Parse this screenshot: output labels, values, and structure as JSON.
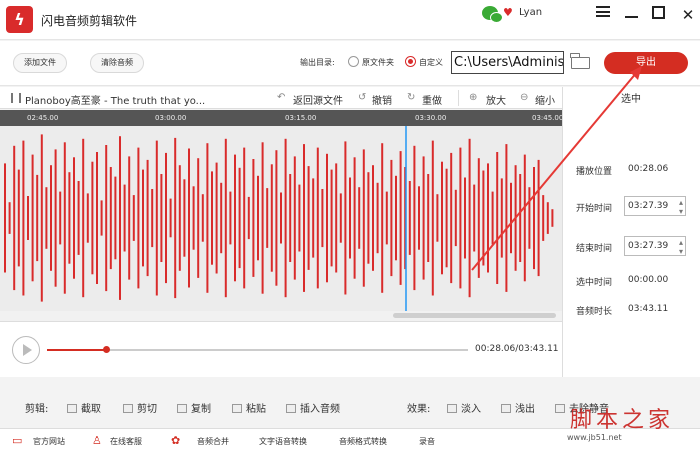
{
  "app": {
    "title": "闪电音频剪辑软件",
    "logo_icon": "lightning-logo-icon",
    "user": "Lyan"
  },
  "toolbar": {
    "add_file": "添加文件",
    "clear_audio": "清除音频",
    "output_label": "输出目录:",
    "option_source": "原文件夹",
    "option_custom": "自定义",
    "output_path": "C:\\Users\\Administrator",
    "export": "导出"
  },
  "editor": {
    "filename": "Planoboy高至豪 - The truth that yo...",
    "return_source": "返回源文件",
    "undo": "撤销",
    "redo": "重做",
    "zoom_in": "放大",
    "zoom_out": "缩小",
    "ticks": [
      "02:45.00",
      "03:00.00",
      "03:15.00",
      "03:30.00",
      "03:45.00"
    ]
  },
  "player": {
    "time": "00:28.06/03:43.11",
    "progress": 0.14
  },
  "side": {
    "title": "选中",
    "play_position_label": "播放位置",
    "play_position": "00:28.06",
    "start_label": "开始时间",
    "start": "03:27.39",
    "end_label": "结束时间",
    "end": "03:27.39",
    "selected_label": "选中时间",
    "selected": "00:00.00",
    "duration_label": "音频时长",
    "duration": "03:43.11"
  },
  "edit": {
    "title": "剪辑:",
    "intercept": "截取",
    "cut": "剪切",
    "copy": "复制",
    "paste": "粘贴",
    "insert": "插入音频",
    "effects_title": "效果:",
    "fade_in": "淡入",
    "fade_out": "浅出",
    "remove_silence": "去除静音"
  },
  "bottom": {
    "website": "官方网站",
    "service": "在线客服",
    "merge": "音频合并",
    "tts": "文字语音转换",
    "format": "音频格式转换",
    "record": "录音"
  },
  "watermark": {
    "text": "脚本之家",
    "url": "www.jb51.net"
  },
  "colors": {
    "accent": "#d42d22",
    "wave": "#d92b2b",
    "playhead": "#2196f3"
  },
  "waveform": [
    0.62,
    0.18,
    0.82,
    0.55,
    0.88,
    0.25,
    0.72,
    0.49,
    0.95,
    0.35,
    0.6,
    0.78,
    0.3,
    0.86,
    0.52,
    0.69,
    0.42,
    0.9,
    0.28,
    0.64,
    0.75,
    0.2,
    0.83,
    0.58,
    0.47,
    0.93,
    0.38,
    0.7,
    0.26,
    0.8,
    0.55,
    0.66,
    0.33,
    0.88,
    0.5,
    0.74,
    0.22,
    0.91,
    0.6,
    0.44,
    0.79,
    0.36,
    0.68,
    0.27,
    0.85,
    0.53,
    0.63,
    0.4,
    0.9,
    0.3,
    0.72,
    0.57,
    0.8,
    0.24,
    0.67,
    0.48,
    0.86,
    0.34,
    0.61,
    0.77,
    0.29,
    0.9,
    0.5,
    0.7,
    0.38,
    0.84,
    0.59,
    0.45,
    0.8,
    0.33,
    0.73,
    0.55,
    0.62,
    0.28,
    0.87,
    0.46,
    0.69,
    0.35,
    0.78,
    0.52,
    0.6,
    0.4,
    0.85,
    0.3,
    0.66,
    0.48,
    0.76,
    0.58,
    0.42,
    0.82,
    0.36,
    0.7,
    0.5,
    0.88,
    0.27,
    0.64,
    0.56,
    0.74,
    0.32,
    0.8,
    0.46,
    0.9,
    0.38,
    0.68,
    0.54,
    0.62,
    0.3,
    0.75,
    0.45,
    0.84,
    0.4,
    0.6,
    0.5,
    0.72,
    0.35,
    0.58,
    0.66,
    0.26,
    0.18,
    0.1
  ]
}
